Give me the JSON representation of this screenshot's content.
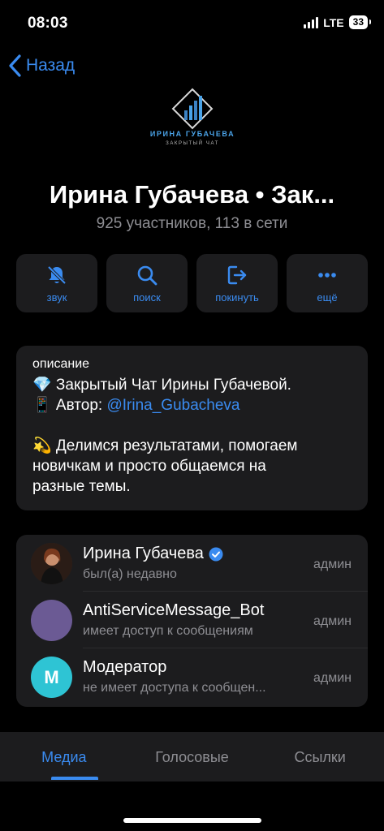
{
  "status_bar": {
    "time": "08:03",
    "network": "LTE",
    "battery": "33"
  },
  "nav": {
    "back_label": "Назад"
  },
  "logo": {
    "line1": "ИРИНА ГУБАЧЕВА",
    "line2": "ЗАКРЫТЫЙ ЧАТ"
  },
  "group": {
    "title": "Ирина Губачева • Зак...",
    "subtitle": "925 участников, 113 в сети"
  },
  "actions": [
    {
      "label": "звук",
      "icon": "bell-slash-icon"
    },
    {
      "label": "поиск",
      "icon": "search-icon"
    },
    {
      "label": "покинуть",
      "icon": "leave-icon"
    },
    {
      "label": "ещё",
      "icon": "more-icon"
    }
  ],
  "description": {
    "title": "описание",
    "line1": "💎 Закрытый Чат Ирины Губачевой.",
    "line2_prefix": "📱 Автор: ",
    "line2_link": "@Irina_Gubacheva",
    "line3": "💫 Делимся результатами, помогаем",
    "line4": "новичкам и просто общаемся на",
    "line5": "разные темы."
  },
  "members": [
    {
      "name": "Ирина Губачева",
      "status": "был(а) недавно",
      "role": "админ",
      "verified": true,
      "avatar_color": "#3a2a22"
    },
    {
      "name": "AntiServiceMessage_Bot",
      "status": "имеет доступ к сообщениям",
      "role": "админ",
      "avatar_color": "#6b5a94"
    },
    {
      "name": "Модератор",
      "status": "не имеет доступа к сообщен...",
      "role": "админ",
      "avatar_letter": "M",
      "avatar_color": "#2ec4d4"
    }
  ],
  "tabs": [
    {
      "label": "Медиа",
      "active": true
    },
    {
      "label": "Голосовые",
      "active": false
    },
    {
      "label": "Ссылки",
      "active": false
    }
  ],
  "colors": {
    "accent": "#3a8bf0",
    "card": "#1c1c1e",
    "secondary_text": "#8e8e93"
  }
}
